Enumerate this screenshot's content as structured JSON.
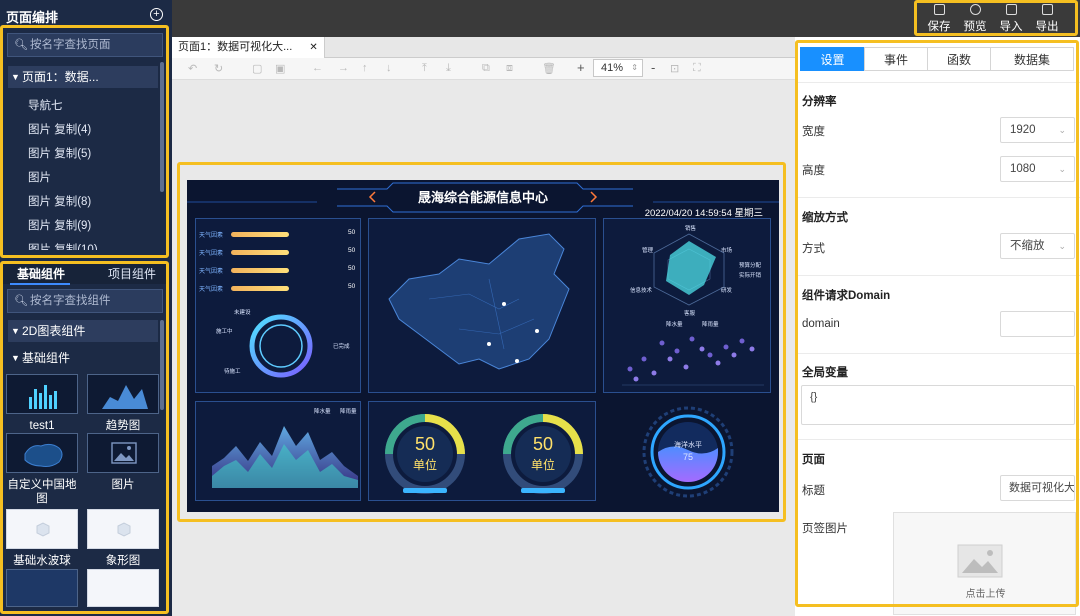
{
  "left": {
    "title": "页面编排",
    "page_search_placeholder": "按名字查找页面",
    "tree_root": "页面1：数据...",
    "tree_items": [
      "导航七",
      "图片 复制(4)",
      "图片 复制(5)",
      "图片",
      "图片 复制(8)",
      "图片 复制(9)",
      "图片 复制(10)"
    ],
    "tabs": [
      "基础组件",
      "项目组件"
    ],
    "component_search_placeholder": "按名字查找组件",
    "categories": [
      "2D图表组件",
      "基础组件"
    ],
    "components": [
      "test1",
      "趋势图",
      "自定义中国地图",
      "图片",
      "基础水波球",
      "象形图"
    ]
  },
  "toolbar": {
    "buttons": [
      "保存",
      "预览",
      "导入",
      "导出"
    ]
  },
  "canvas": {
    "tab_title": "页面1：数据可视化大...",
    "close_glyph": "✕",
    "zoom": "41%",
    "zoom_plus": "+",
    "zoom_minus": "-"
  },
  "dashboard": {
    "title": "晟海综合能源信息中心",
    "datetime": "2022/04/20 14:59:54 星期三",
    "bars": [
      {
        "label": "天气因素",
        "value": 50,
        "level": 0.62
      },
      {
        "label": "天气因素",
        "value": 50,
        "level": 0.62
      },
      {
        "label": "天气因素",
        "value": 50,
        "level": 0.62
      },
      {
        "label": "天气因素",
        "value": 50,
        "level": 0.62
      }
    ],
    "ring_labels": [
      "未建设",
      "施工中",
      "已完成",
      "待施工"
    ],
    "radar_labels": [
      "销售",
      "管理",
      "市场",
      "信息技术",
      "研发",
      "客服"
    ],
    "radar_legend": [
      "预算分配",
      "实际开销"
    ],
    "scatter_legend": [
      "降水量",
      "降雨量"
    ],
    "scatter_y_ticks": [
      "100",
      "80",
      "60",
      "40",
      "20",
      "0"
    ],
    "scatter_x_ticks": [
      "10",
      "20",
      "30",
      "40",
      "50",
      "60",
      "70",
      "80",
      "90",
      "100",
      "110",
      "120"
    ],
    "area_legend": [
      "降水量",
      "降雨量"
    ],
    "area_y_ticks": [
      "300",
      "250",
      "200",
      "150",
      "100",
      "50",
      "0"
    ],
    "area_x_ticks": [
      "1月",
      "2月",
      "3月",
      "4月",
      "5月",
      "6月",
      "7月",
      "8月",
      "9月",
      "10月",
      "11月",
      "12月"
    ],
    "gauges": [
      {
        "value": "50",
        "unit": "单位",
        "level": 0.5
      },
      {
        "value": "50",
        "unit": "单位",
        "level": 0.5
      }
    ],
    "wave": {
      "label": "海洋水平",
      "value": "75"
    }
  },
  "right": {
    "tabs": [
      "设置",
      "事件",
      "函数",
      "数据集"
    ],
    "sections": {
      "resolution": "分辨率",
      "width_label": "宽度",
      "width_value": "1920",
      "height_label": "高度",
      "height_value": "1080",
      "scale": "缩放方式",
      "mode_label": "方式",
      "mode_value": "不缩放",
      "domain_section": "组件请求Domain",
      "domain_label": "domain",
      "globals": "全局变量",
      "globals_value": "{}",
      "page": "页面",
      "title_label": "标题",
      "title_value": "数据可视化大",
      "tab_image_label": "页签图片",
      "upload_text": "点击上传"
    }
  },
  "colors": {
    "accent": "#1890ff",
    "highlight": "#f5bf21",
    "panel_bg": "#1c2a45",
    "dash_bg": "#0b1530"
  }
}
